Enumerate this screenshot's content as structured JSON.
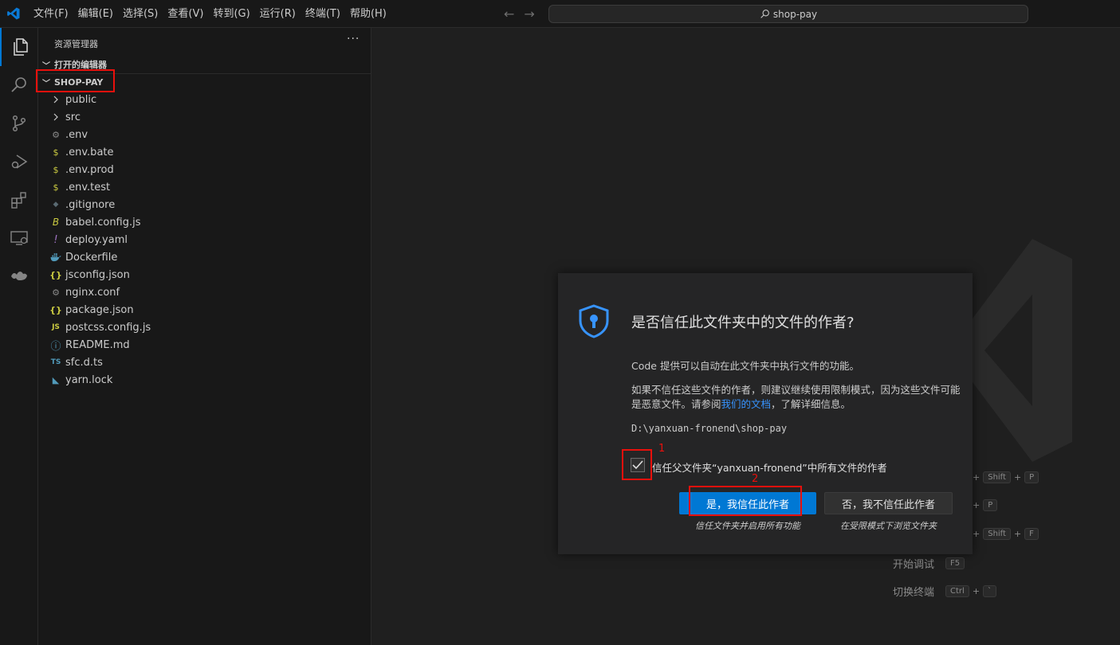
{
  "menu": {
    "items": [
      "文件(F)",
      "编辑(E)",
      "选择(S)",
      "查看(V)",
      "转到(G)",
      "运行(R)",
      "终端(T)",
      "帮助(H)"
    ]
  },
  "search": {
    "text": "shop-pay"
  },
  "activity": {
    "icons": [
      "explorer-icon",
      "search-icon",
      "source-control-icon",
      "run-debug-icon",
      "extensions-icon",
      "remote-explorer-icon",
      "docker-icon"
    ]
  },
  "sidebar": {
    "title": "资源管理器",
    "more": "···",
    "open_editors": "打开的编辑器",
    "project": "SHOP-PAY",
    "files": [
      {
        "name": "public",
        "icon": "chevron-right-icon",
        "color": "#cccccc"
      },
      {
        "name": "src",
        "icon": "chevron-right-icon",
        "color": "#cccccc"
      },
      {
        "name": ".env",
        "icon": "gear-icon",
        "color": "#8a8a8a"
      },
      {
        "name": ".env.bate",
        "icon": "dollar-icon",
        "color": "#cbcb41"
      },
      {
        "name": ".env.prod",
        "icon": "dollar-icon",
        "color": "#cbcb41"
      },
      {
        "name": ".env.test",
        "icon": "dollar-icon",
        "color": "#cbcb41"
      },
      {
        "name": ".gitignore",
        "icon": "git-icon",
        "color": "#41535b"
      },
      {
        "name": "babel.config.js",
        "icon": "babel-icon",
        "color": "#cbcb41"
      },
      {
        "name": "deploy.yaml",
        "icon": "exclamation-icon",
        "color": "#a074c4"
      },
      {
        "name": "Dockerfile",
        "icon": "docker-icon",
        "color": "#519aba"
      },
      {
        "name": "jsconfig.json",
        "icon": "braces-icon",
        "color": "#cbcb41"
      },
      {
        "name": "nginx.conf",
        "icon": "gear-icon",
        "color": "#8a8a8a"
      },
      {
        "name": "package.json",
        "icon": "braces-icon",
        "color": "#cbcb41"
      },
      {
        "name": "postcss.config.js",
        "icon": "js-icon",
        "color": "#cbcb41"
      },
      {
        "name": "README.md",
        "icon": "info-icon",
        "color": "#519aba"
      },
      {
        "name": "sfc.d.ts",
        "icon": "ts-icon",
        "color": "#519aba"
      },
      {
        "name": "yarn.lock",
        "icon": "yarn-icon",
        "color": "#519aba"
      }
    ]
  },
  "file_glyphs": {
    "gear": "⚙",
    "dollar": "$",
    "git": "◆",
    "babel": "B",
    "exclamation": "!",
    "braces": "{}",
    "js": "JS",
    "info": "ⓘ",
    "ts": "TS",
    "yarn": "◣",
    "docker": "▆"
  },
  "hints": {
    "debug_label": "开始调试",
    "terminal_label": "切换终端",
    "keys": {
      "shift": "Shift",
      "p": "P",
      "f": "F",
      "f5": "F5",
      "ctrl": "Ctrl",
      "backtick": "`",
      "plus": "+"
    }
  },
  "dialog": {
    "title": "是否信任此文件夹中的文件的作者?",
    "p1": "Code 提供可以自动在此文件夹中执行文件的功能。",
    "p2_before": "如果不信任这些文件的作者，则建议继续使用限制模式，因为这些文件可能是恶意文件。请参阅",
    "p2_link": "我们的文档",
    "p2_after": "，了解详细信息。",
    "path": "D:\\yanxuan-fronend\\shop-pay",
    "checkbox_label": "信任父文件夹“yanxuan-fronend”中所有文件的作者",
    "checkbox_checked": true,
    "trust_button": "是，我信任此作者",
    "trust_sub": "信任文件夹并启用所有功能",
    "no_trust_button": "否，我不信任此作者",
    "no_trust_sub": "在受限模式下浏览文件夹"
  },
  "annotations": {
    "label1": "1",
    "label2": "2"
  },
  "colors": {
    "accent": "#0078d4",
    "annotation": "#e8100c",
    "link": "#3794ff"
  }
}
